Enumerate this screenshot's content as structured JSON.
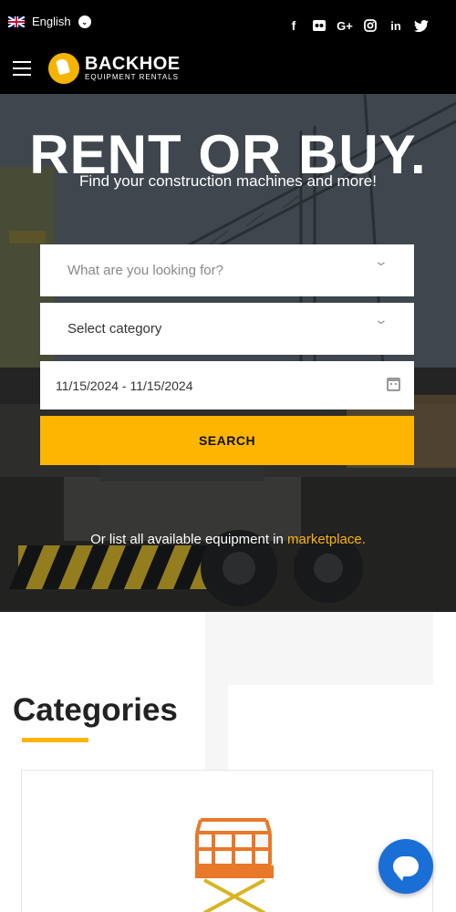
{
  "topbar": {
    "language": "English",
    "socials": [
      "facebook-icon",
      "flickr-icon",
      "google-plus-icon",
      "instagram-icon",
      "linkedin-icon",
      "twitter-icon"
    ],
    "social_glyphs": {
      "facebook": "f",
      "flickr": "••",
      "googleplus": "G+",
      "instagram": "◎",
      "linkedin": "in",
      "twitter": "🐦"
    }
  },
  "nav": {
    "logo_main": "BACKHOE",
    "logo_sub": "EQUIPMENT RENTALS"
  },
  "hero": {
    "title": "RENT OR BUY.",
    "subtitle": "Find your construction machines and more!",
    "search_placeholder": "What are you looking for?",
    "category_value": "Select category",
    "date_value": "11/15/2024 - 11/15/2024",
    "search_label": "SEARCH",
    "marketplace_prefix": "Or list all available equipment in ",
    "marketplace_link": "marketplace."
  },
  "categories": {
    "title": "Categories"
  },
  "colors": {
    "accent": "#fdb500",
    "chat": "#1a6fd6",
    "topbar": "#000000"
  }
}
